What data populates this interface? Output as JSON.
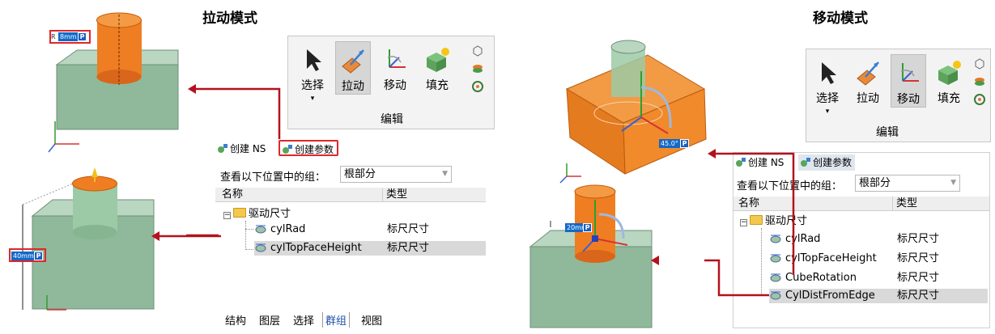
{
  "titles": {
    "left": "拉动模式",
    "right": "移动模式"
  },
  "ribbon": {
    "buttons": [
      {
        "label": "选择",
        "icon": "cursor-arrow-icon"
      },
      {
        "label": "拉动",
        "icon": "pull-icon"
      },
      {
        "label": "移动",
        "icon": "move-icon"
      },
      {
        "label": "填充",
        "icon": "fill-icon"
      }
    ],
    "group_label": "编辑",
    "dropdown_arrow": "▾",
    "left_selected": "拉动",
    "right_selected": "移动"
  },
  "panel": {
    "tabs": {
      "create_ns": "创建 NS",
      "create_param": "创建参数"
    },
    "look_label": "查看以下位置中的组：",
    "combo_value": "根部分",
    "columns": {
      "name": "名称",
      "type": "类型"
    },
    "folder": {
      "toggle": "−",
      "label": "驱动尺寸"
    },
    "left_rows": [
      {
        "name": "cylRad",
        "type": "标尺尺寸"
      },
      {
        "name": "cylTopFaceHeight",
        "type": "标尺尺寸"
      }
    ],
    "right_rows": [
      {
        "name": "cylRad",
        "type": "标尺尺寸"
      },
      {
        "name": "cylTopFaceHeight",
        "type": "标尺尺寸"
      },
      {
        "name": "CubeRotation",
        "type": "标尺尺寸"
      },
      {
        "name": "CylDistFromEdge",
        "type": "标尺尺寸"
      }
    ],
    "bottom_tabs": [
      "结构",
      "图层",
      "选择",
      "群组",
      "视图"
    ]
  },
  "viewport_labels": {
    "radius_prefix": "R",
    "radius_value": "8mm",
    "height_value": "40mm",
    "angle_value": "45.0°",
    "dist_value": "20mm",
    "param_marker": "P"
  },
  "colors": {
    "accent_red": "#e0262a",
    "arrow_red": "#b3121d",
    "cube_green": "#8fb99a",
    "cylinder_orange": "#ef7d22",
    "selected_orange": "#f08a2a"
  }
}
